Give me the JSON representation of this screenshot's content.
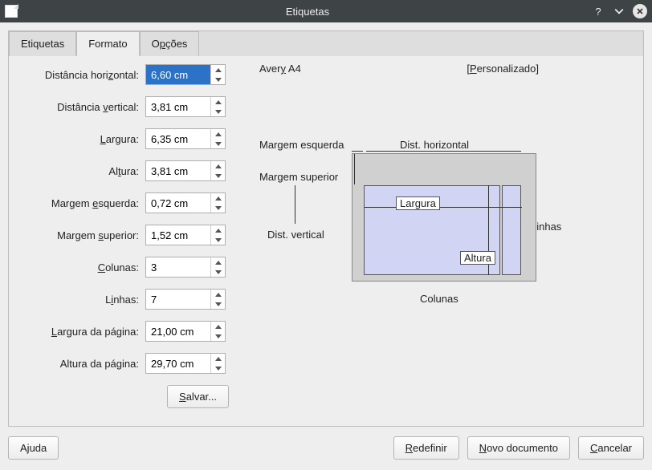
{
  "titlebar": {
    "title": "Etiquetas"
  },
  "tabs": {
    "etiquetas": "Etiquetas",
    "formato": "Formato",
    "opcoes_pre": "O",
    "opcoes_u": "p",
    "opcoes_post": "ções"
  },
  "fields": {
    "dist_h": {
      "label_pre": "Distância hori",
      "label_u": "z",
      "label_post": "ontal:",
      "value": "6,60 cm"
    },
    "dist_v": {
      "label_pre": "Distância ",
      "label_u": "v",
      "label_post": "ertical:",
      "value": "3,81 cm"
    },
    "largura": {
      "label_u": "L",
      "label_post": "argura:",
      "value": "6,35 cm"
    },
    "altura": {
      "label_pre": "Al",
      "label_u": "t",
      "label_post": "ura:",
      "value": "3,81 cm"
    },
    "marg_e": {
      "label_pre": "Margem ",
      "label_u": "e",
      "label_post": "squerda:",
      "value": "0,72 cm"
    },
    "marg_s": {
      "label_pre": "Margem ",
      "label_u": "s",
      "label_post": "uperior:",
      "value": "1,52 cm"
    },
    "colunas": {
      "label_u": "C",
      "label_post": "olunas:",
      "value": "3"
    },
    "linhas": {
      "label_pre": "L",
      "label_u": "i",
      "label_post": "nhas:",
      "value": "7"
    },
    "larg_p": {
      "label_u": "L",
      "label_post": "argura da página:",
      "value": "21,00 cm"
    },
    "alt_p": {
      "label_pre": "Altura da pá",
      "label_u": "g",
      "label_post": "ina:",
      "value": "29,70 cm"
    }
  },
  "save_btn": {
    "pre": "",
    "u": "S",
    "post": "alvar..."
  },
  "preview": {
    "brand_pre": "Aver",
    "brand_u": "y",
    "brand_post": " A4",
    "format_pre": "[",
    "format_u": "P",
    "format_post": "ersonalizado]",
    "marg_esq": "Margem esquerda",
    "dist_h": "Dist. horizontal",
    "marg_sup": "Margem superior",
    "dist_v_pre": "Di",
    "dist_v_post": "st. vertical",
    "largura": "Largura",
    "altura": "Altura",
    "linhas": "Linhas",
    "colunas": "Colunas"
  },
  "buttons": {
    "ajuda": {
      "pre": "A",
      "u": "j",
      "post": "uda"
    },
    "redefinir": {
      "u": "R",
      "post": "edefinir"
    },
    "novo": {
      "u": "N",
      "post": "ovo documento"
    },
    "cancelar": {
      "u": "C",
      "post": "ancelar"
    }
  }
}
